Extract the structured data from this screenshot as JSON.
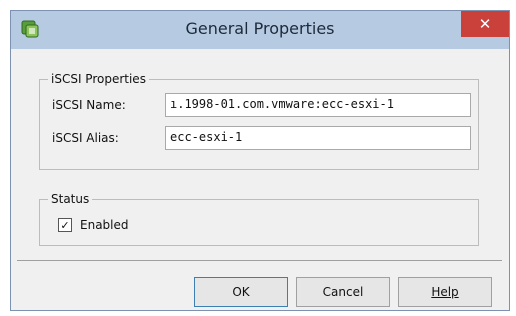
{
  "window": {
    "title": "General Properties",
    "close_label": "✕"
  },
  "iscsi_properties": {
    "legend": "iSCSI Properties",
    "name_label": "iSCSI Name:",
    "name_value": "ı.1998-01.com.vmware:ecc-esxi-1",
    "alias_label": "iSCSI Alias:",
    "alias_value": "ecc-esxi-1"
  },
  "status": {
    "legend": "Status",
    "enabled_label": "Enabled",
    "enabled_checked": true,
    "check_glyph": "✓"
  },
  "buttons": {
    "ok": "OK",
    "cancel": "Cancel",
    "help": "Help"
  },
  "colors": {
    "titlebar": "#b6cbe2",
    "close": "#c9413a",
    "client": "#f0f0f0"
  }
}
